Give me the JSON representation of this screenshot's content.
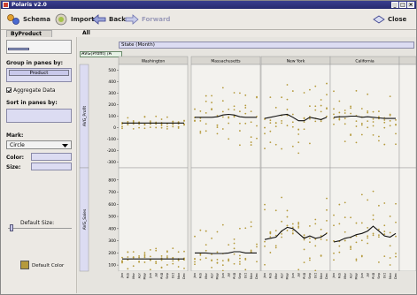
{
  "window": {
    "title": "Polaris v2.0",
    "controls": [
      "_",
      "□",
      "×"
    ]
  },
  "toolbar": {
    "schema_label": "Schema",
    "import_label": "Import",
    "back_label": "Back",
    "forward_label": "Forward",
    "close_label": "Close"
  },
  "tabs": [
    "ByProduct",
    "All"
  ],
  "left_panel": {
    "group_label": "Group in panes by:",
    "group_field": "Product",
    "aggregate_label": "Aggregate Data",
    "aggregate_checked": true,
    "sort_label": "Sort in panes by:",
    "mark_label": "Mark:",
    "mark_value": "Circle",
    "color_label": "Color:",
    "size_label": "Size:",
    "default_size_label": "Default Size:",
    "default_color_label": "Default Color",
    "default_color": "#b59a3c"
  },
  "shelves": {
    "x_shelf": "State   (Month)",
    "y_shelf": "AVG(Profit)  /A"
  },
  "chart_data": {
    "type": "scatter",
    "columns": [
      "Washington",
      "Massachusetts",
      "New York",
      "California"
    ],
    "rows": [
      {
        "ylabel": "AVG_Profit",
        "ticks": [
          500,
          400,
          300,
          200,
          100,
          0,
          -100,
          -200,
          -300
        ],
        "ylim": [
          -350,
          550
        ]
      },
      {
        "ylabel": "AVG_Sales",
        "ticks": [
          800,
          700,
          600,
          500,
          400,
          300,
          200,
          100
        ],
        "ylim": [
          50,
          900
        ]
      }
    ],
    "x_ticks": [
      "Jan",
      "Feb",
      "Mar",
      "Apr",
      "May",
      "Jun",
      "Jul",
      "Aug",
      "Sep",
      "Oct",
      "Nov",
      "Dec"
    ],
    "point_color": "#b59a3c",
    "line_color": "#111111",
    "mean_lines": {
      "profit": [
        [
          40,
          40,
          40,
          40,
          40,
          40,
          40,
          40,
          40,
          40,
          40,
          40
        ],
        [
          90,
          90,
          90,
          90,
          95,
          110,
          115,
          110,
          95,
          90,
          90,
          90
        ],
        [
          80,
          90,
          100,
          110,
          115,
          90,
          60,
          60,
          90,
          80,
          70,
          90
        ],
        [
          90,
          95,
          95,
          100,
          100,
          90,
          95,
          90,
          85,
          80,
          80,
          80
        ]
      ],
      "sales": [
        [
          150,
          150,
          150,
          150,
          150,
          150,
          150,
          150,
          150,
          150,
          150,
          150
        ],
        [
          200,
          200,
          200,
          195,
          195,
          195,
          200,
          210,
          210,
          200,
          200,
          200
        ],
        [
          310,
          320,
          330,
          380,
          410,
          400,
          360,
          320,
          340,
          320,
          330,
          360
        ],
        [
          290,
          300,
          320,
          330,
          350,
          360,
          380,
          420,
          380,
          340,
          330,
          360
        ]
      ]
    }
  }
}
